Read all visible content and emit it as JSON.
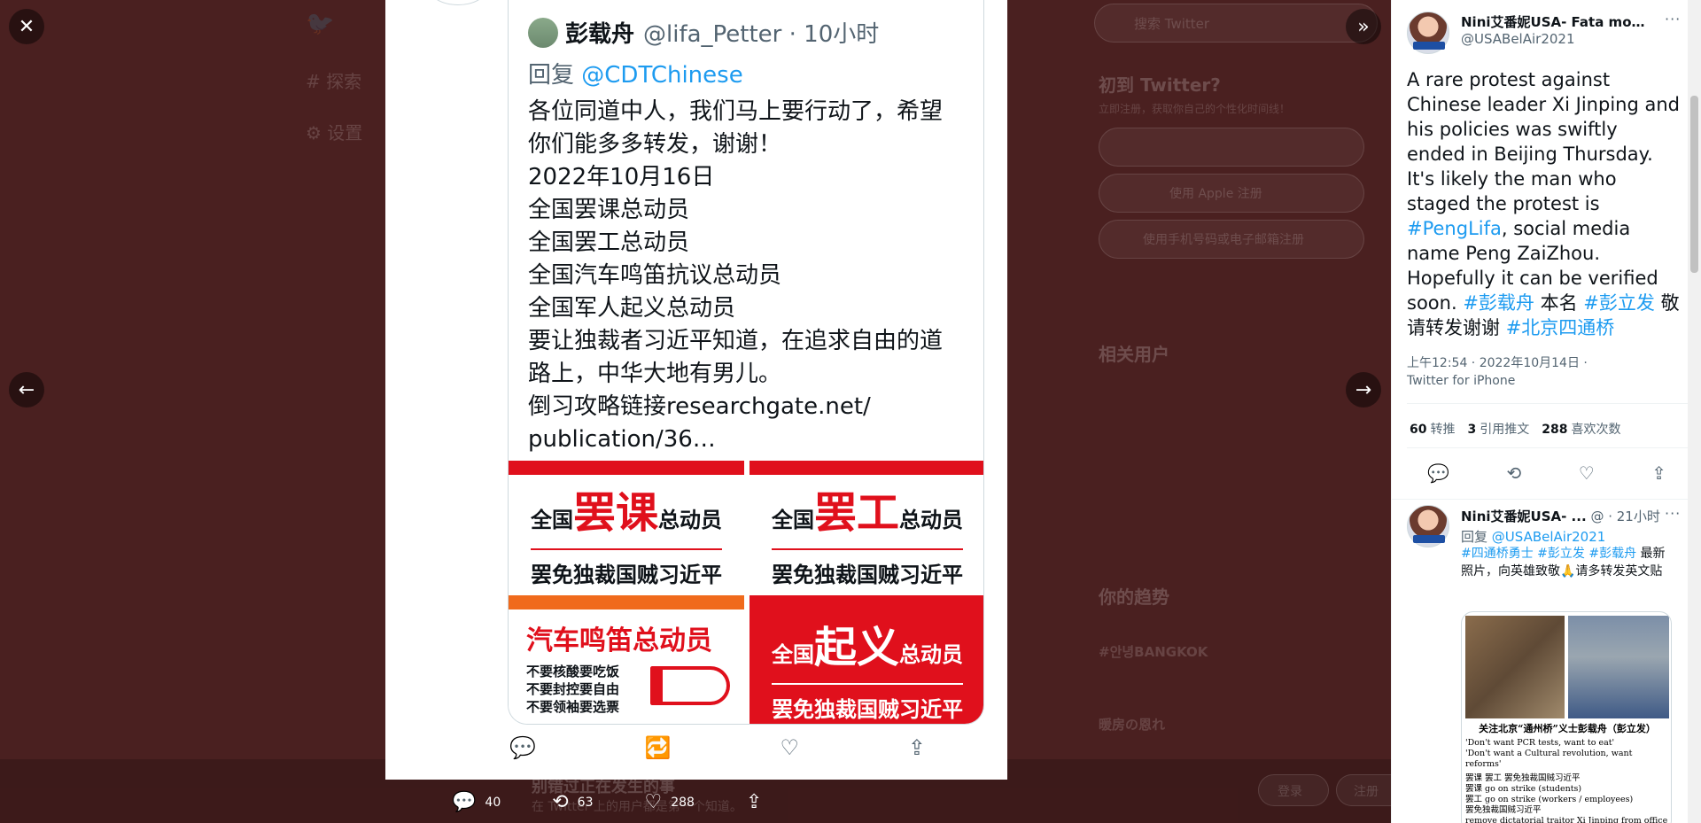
{
  "background": {
    "nav": [
      "探索",
      "设置"
    ],
    "search_placeholder": "搜索 Twitter",
    "signup_title": "初到 Twitter?",
    "signup_sub": "立即注册，获取你自己的个性化时间线！",
    "apple_signup": "使用 Apple 注册",
    "phone_signup": "使用手机号码或电子邮箱注册",
    "related_users": "相关用户",
    "trends_title": "你的趋势",
    "trend_1": "#안녕BANGKOK",
    "trend_2": "暖房の恩れ",
    "login": "登录",
    "register": "注册",
    "bottom_text": "别错过正在发生的事",
    "bottom_sub": "在 Twitter 上的用户都是第一个知道。"
  },
  "controls": {
    "close": "✕",
    "expand": "»",
    "prev": "←",
    "next": "→"
  },
  "media_tweet": {
    "name": "彭载舟",
    "handle": "@lifa_Petter · 10小时",
    "reply_prefix": "回复",
    "reply_to": "@CDTChinese",
    "lines": [
      "各位同道中人，我们马上要行动了，希望",
      "你们能多多转发，谢谢！",
      "2022年10月16日",
      "全国罢课总动员",
      "全国罢工总动员",
      "全国汽车鸣笛抗议总动员",
      "全国军人起义总动员",
      "要让独裁者习近平知道，在追求自由的道",
      "路上，中华大地有男儿。",
      "倒习攻略链接researchgate.net/",
      "publication/36…"
    ],
    "posters": {
      "p1_pre": "全国",
      "p1_big": "罢课",
      "p1_post": "总动员",
      "p1_sub": "罢免独裁国贼习近平",
      "p2_pre": "全国",
      "p2_big": "罢工",
      "p2_post": "总动员",
      "p2_sub": "罢免独裁国贼习近平",
      "p3_title": "汽车鸣笛总动员",
      "p3_line1": "不要核酸要吃饭",
      "p3_line2": "不要封控要自由",
      "p3_line3": "不要领袖要选票",
      "p4_pre": "全国",
      "p4_big": "起义",
      "p4_post": "总动员",
      "p4_sub": "罢免独裁国贼习近平"
    }
  },
  "bottom_actions": {
    "replies": "40",
    "retweets": "63",
    "likes": "288"
  },
  "right_panel": {
    "author_name": "Nini艾番妮USA- Fata morg...",
    "author_handle": "@USABelAir2021",
    "more": "···",
    "text_1": "A rare protest against Chinese leader Xi Jinping and his policies was swiftly ended in Beijing Thursday. It's likely the man who staged the protest is ",
    "hashtag_1": "#PengLifa",
    "text_2": ", social media name Peng ZaiZhou. Hopefully it can be verified soon. ",
    "hashtag_2": "#彭载舟",
    "text_3": " 本名 ",
    "hashtag_3": "#彭立发",
    "text_4": " 敬请转发谢谢 ",
    "hashtag_4": "#北京四通桥",
    "timestamp": "上午12:54 · 2022年10月14日 ·",
    "source": "Twitter for iPhone",
    "retweets_count": "60",
    "retweets_label": "转推",
    "quotes_count": "3",
    "quotes_label": "引用推文",
    "likes_count": "288",
    "likes_label": "喜欢次数",
    "reply2_name": "Nini艾番妮USA- ...",
    "reply2_time": "@ · 21小时",
    "reply2_prefix": "回复",
    "reply2_to": "@USABelAir2021",
    "reply2_tags": "#四通桥勇士 #彭立发 #彭载舟",
    "reply2_text": " 最新照片，向英雄致敬🙏请多转发英文贴",
    "img_head": "关注北京“通州桥”义士彭载舟（彭立发）",
    "img_l1": "'Don't want PCR tests, want to eat'",
    "img_l2": "'Don't want a Cultural revolution, want reforms'",
    "img_l3": "罢课 罢工 罢免独裁国贼习近平",
    "img_l4": "罢课 go on strike (students)",
    "img_l5": "罢工 go on strike (workers / employees)",
    "img_l6": "罢免独裁国贼习近平",
    "img_l7": "remove dictatorial traitor Xi Jinping from office"
  }
}
